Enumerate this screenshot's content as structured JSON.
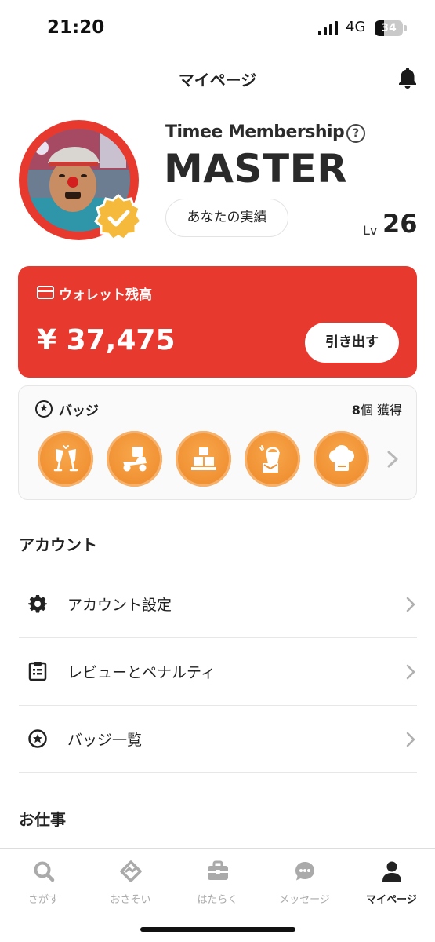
{
  "status_bar": {
    "time": "21:20",
    "network": "4G",
    "battery": "34",
    "battery_level": 0.34
  },
  "header": {
    "title": "マイページ",
    "bell_icon": "bell-icon"
  },
  "profile": {
    "membership_label": "Timee Membership",
    "rank": "MASTER",
    "achievements_button": "あなたの実績",
    "level_prefix": "Lv",
    "level_value": "26",
    "colors": {
      "ring": "#e8392e",
      "badge": "#f5b93b"
    }
  },
  "wallet": {
    "label": "ウォレット残高",
    "amount": "¥ 37,475",
    "withdraw_button": "引き出す",
    "color": "#e8392e"
  },
  "badges": {
    "title": "バッジ",
    "count_number": "8",
    "count_suffix": "個 獲得",
    "icons": [
      "cheers-icon",
      "delivery-scooter-icon",
      "boxes-icon",
      "cleaning-bucket-icon",
      "chef-hat-icon"
    ],
    "color": "#f09133"
  },
  "account_section": {
    "title": "アカウント",
    "items": [
      {
        "label": "アカウント設定",
        "icon": "gear-icon"
      },
      {
        "label": "レビューとペナルティ",
        "icon": "clipboard-icon"
      },
      {
        "label": "バッジ一覧",
        "icon": "star-icon"
      }
    ]
  },
  "work_section": {
    "title": "お仕事"
  },
  "tab_bar": {
    "tabs": [
      {
        "label": "さがす",
        "icon": "search-icon"
      },
      {
        "label": "おさそい",
        "icon": "handshake-icon"
      },
      {
        "label": "はたらく",
        "icon": "briefcase-icon"
      },
      {
        "label": "メッセージ",
        "icon": "chat-icon"
      },
      {
        "label": "マイページ",
        "icon": "person-icon",
        "active": true
      }
    ]
  }
}
